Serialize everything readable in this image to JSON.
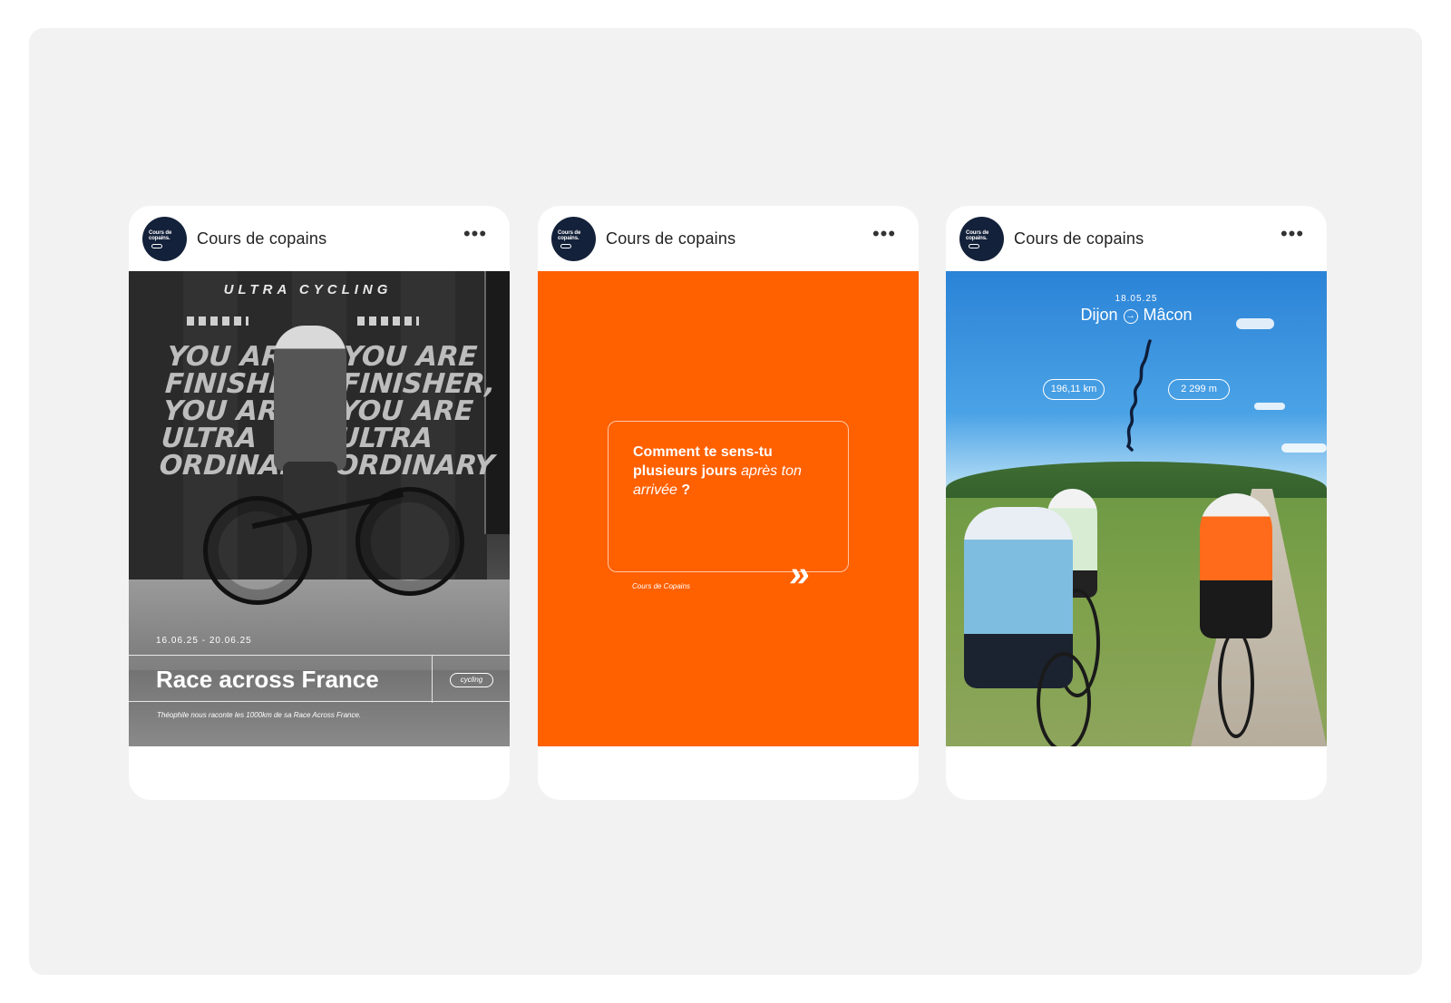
{
  "cards": [
    {
      "account": "Cours de copains",
      "avatar_text": "Cours de copains.",
      "poster": {
        "header": "ULTRA CYCLING",
        "wall_left": [
          "YOU ARE",
          "FINISHER,",
          "YOU ARE",
          "ULTRA",
          "ORDINARY"
        ],
        "wall_right": [
          "YOU ARE",
          "FINISHER,",
          "YOU ARE",
          "ULTRA",
          "ORDINARY"
        ],
        "date_range": "16.06.25 - 20.06.25",
        "title": "Race across France",
        "tag": "cycling",
        "caption": "Théophile nous raconte les 1000km de sa Race Across France."
      }
    },
    {
      "account": "Cours de copains",
      "avatar_text": "Cours de copains.",
      "quote": {
        "bold_part": "Comment te sens-tu plusieurs jours",
        "italic_part": "après ton arrivée",
        "end_part": " ?",
        "brand": "Cours de Copains",
        "next_icon": "»"
      }
    },
    {
      "account": "Cours de copains",
      "avatar_text": "Cours de copains.",
      "route": {
        "date": "18.05.25",
        "from": "Dijon",
        "to": "Mâcon",
        "distance": "196,11 km",
        "elevation": "2 299 m"
      }
    }
  ],
  "more_label": "•••",
  "colors": {
    "stage": "#f2f2f2",
    "avatar": "#13213a",
    "orange": "#ff6000"
  }
}
